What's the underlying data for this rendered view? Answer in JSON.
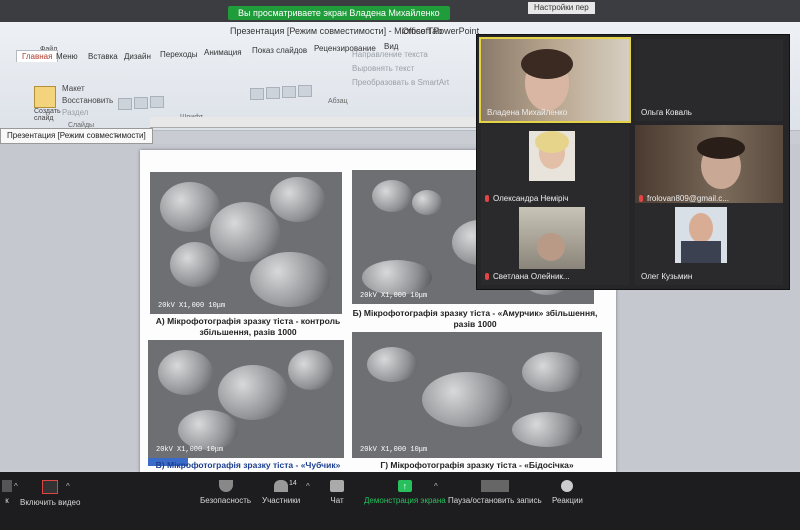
{
  "banner": {
    "viewing_text": "Вы просматриваете экран Владена Михайленко",
    "settings_text": "Настройки пер"
  },
  "window": {
    "title": "Презентация [Режим совместимости] - Microsoft PowerPoint",
    "office_tab": "Office Tab",
    "file_label": "Файл"
  },
  "ribbon": {
    "tabs": [
      "Главная",
      "Меню",
      "Вставка",
      "Дизайн",
      "Переходы",
      "Анимация",
      "Показ слайдов",
      "Рецензирование",
      "Вид"
    ],
    "active_tab": "Главная",
    "paste_label": "Создать слайд",
    "layout_label": "Макет",
    "restore_label": "Восстановить",
    "section_label": "Раздел",
    "slides_group": "Слайды",
    "font_group": "Шрифт",
    "paragraph_group": "Абзац",
    "text_direction": "Направление текста",
    "align_text": "Выровнять текст",
    "smartart": "Преобразовать в SmartArt"
  },
  "document_tab": {
    "label": "Презентация [Режим совместимости]",
    "close": "×"
  },
  "slide": {
    "scale_text": "20kV   X1,000   10μm",
    "captions": [
      "А) Мікрофотографія  зразку тіста - контроль збільшення, разів 1000",
      "Б) Мікрофотографія  зразку  тіста  - «Амурчик» збільшення,  разів 1000",
      "В) Мікрофотографія  зразку тіста - «Чубчик»",
      "Г) Мікрофотографія  зразку  тіста  - «Бідосічка»"
    ]
  },
  "participants_panel": {
    "tiles": [
      {
        "name": "Владена Михайленко",
        "muted": false,
        "active": true
      },
      {
        "name": "Ольга Коваль",
        "muted": false,
        "active": false
      },
      {
        "name": "Олександра Неміріч",
        "muted": true,
        "active": false
      },
      {
        "name": "frolovan809@gmail.c...",
        "muted": true,
        "active": false
      },
      {
        "name": "Светлана Олейник...",
        "muted": true,
        "active": false
      },
      {
        "name": "Олег Кузьмин",
        "muted": false,
        "active": false
      }
    ]
  },
  "controls": {
    "video": "Включить видео",
    "audio_fragment": "к",
    "security": "Безопасность",
    "participants": "Участники",
    "participants_count": "14",
    "chat": "Чат",
    "share_screen": "Демонстрация экрана",
    "pause_record": "Пауза/остановить запись",
    "reactions": "Реакции"
  },
  "colors": {
    "zoom_green": "#27c05c",
    "banner_green": "#1f9d3a",
    "active_speaker": "#e4d445",
    "mute_red": "#e04646"
  }
}
